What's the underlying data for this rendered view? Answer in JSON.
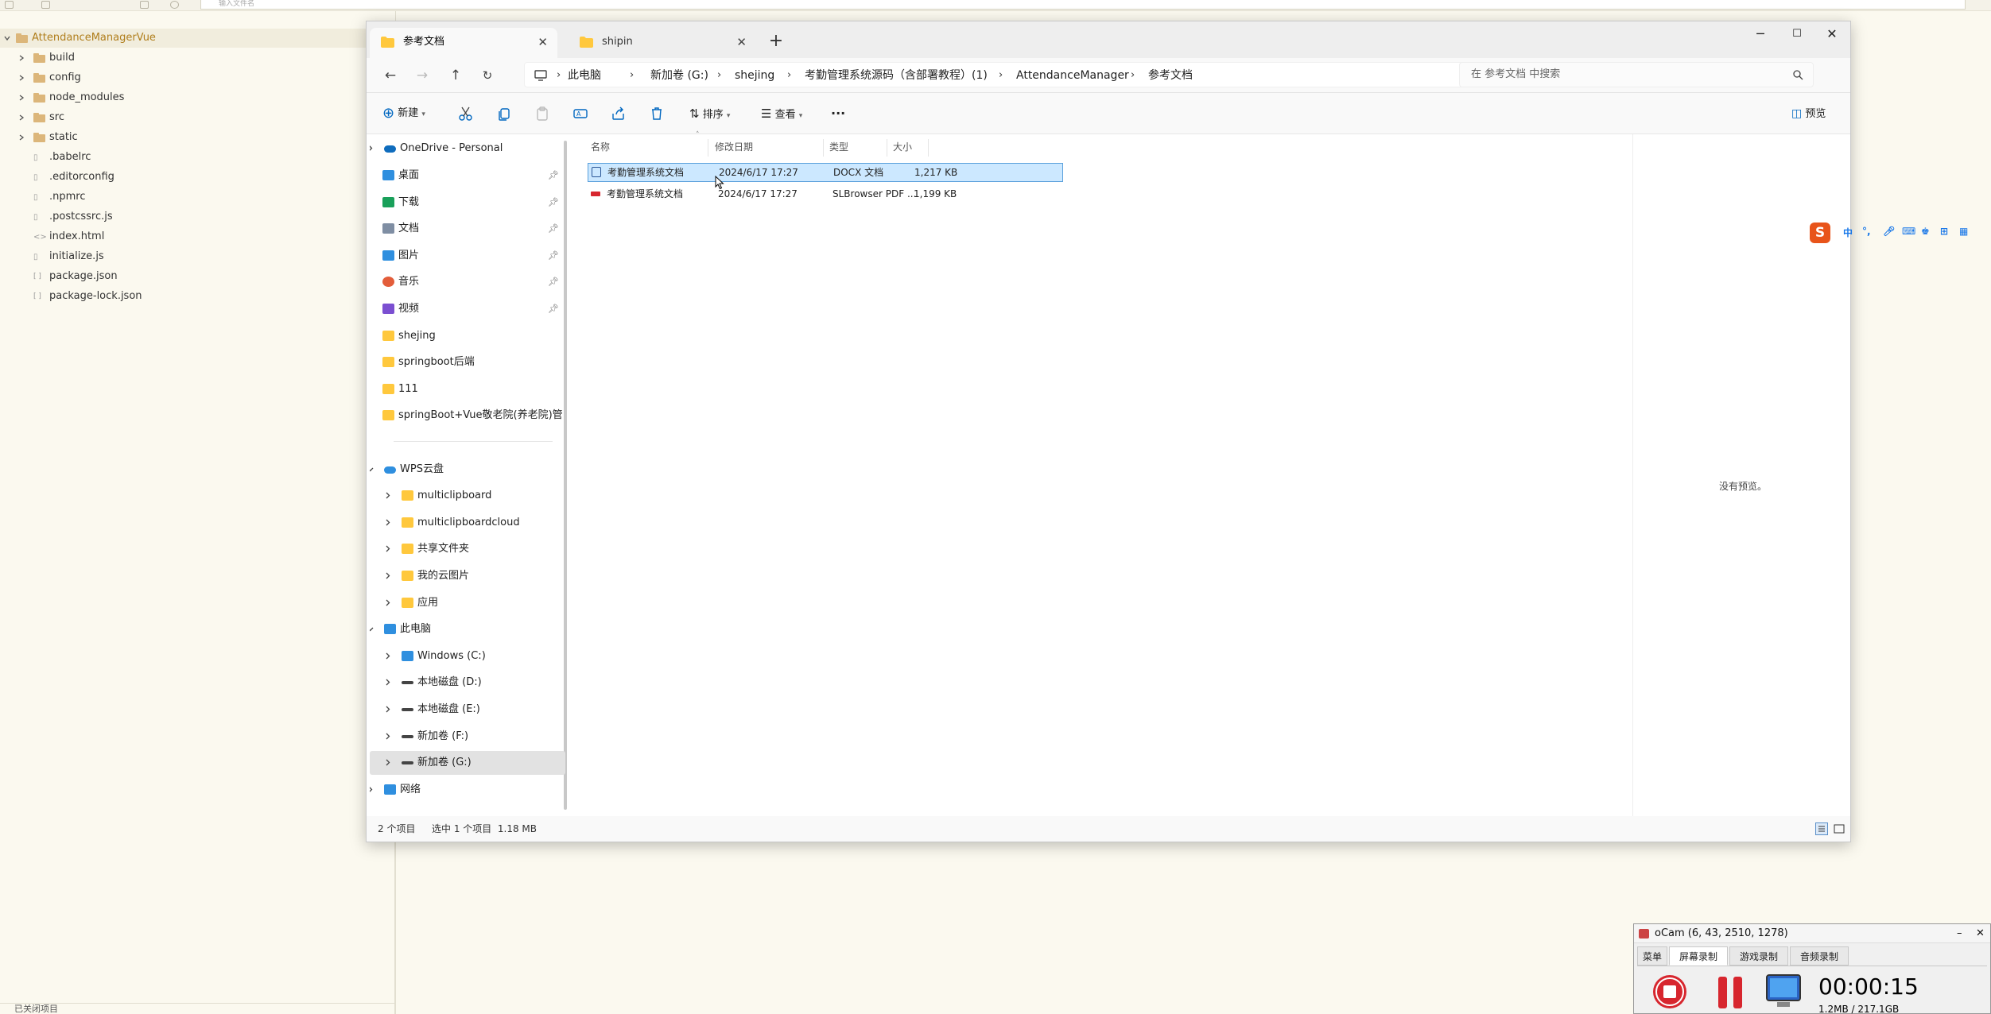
{
  "ide": {
    "search_placeholder": "输入文件名",
    "tree": [
      {
        "label": "AttendanceManagerVue",
        "type": "root-folder",
        "expanded": true
      },
      {
        "label": "build",
        "type": "folder"
      },
      {
        "label": "config",
        "type": "folder"
      },
      {
        "label": "node_modules",
        "type": "folder"
      },
      {
        "label": "src",
        "type": "folder"
      },
      {
        "label": "static",
        "type": "folder"
      },
      {
        "label": ".babelrc",
        "type": "file"
      },
      {
        "label": ".editorconfig",
        "type": "file"
      },
      {
        "label": ".npmrc",
        "type": "file"
      },
      {
        "label": ".postcssrc.js",
        "type": "file"
      },
      {
        "label": "index.html",
        "type": "file"
      },
      {
        "label": "initialize.js",
        "type": "file"
      },
      {
        "label": "package.json",
        "type": "file"
      },
      {
        "label": "package-lock.json",
        "type": "file"
      }
    ],
    "bottom_label": "已关闭项目"
  },
  "explorer": {
    "tabs": [
      {
        "label": "参考文档",
        "active": true
      },
      {
        "label": "shipin",
        "active": false
      }
    ],
    "breadcrumb": [
      "此电脑",
      "新加卷 (G:)",
      "shejing",
      "考勤管理系统源码（含部署教程）(1)",
      "AttendanceManager",
      "参考文档"
    ],
    "search_placeholder": "在 参考文档 中搜索",
    "toolbar": {
      "new_label": "新建",
      "sort_label": "排序",
      "view_label": "查看",
      "more_label": "···",
      "preview_label": "预览"
    },
    "nav": {
      "onedrive": "OneDrive - Personal",
      "quick_access": [
        {
          "label": "桌面",
          "icon": "desktop-icon",
          "pinned": true
        },
        {
          "label": "下载",
          "icon": "download-icon",
          "pinned": true
        },
        {
          "label": "文档",
          "icon": "documents-icon",
          "pinned": true
        },
        {
          "label": "图片",
          "icon": "pictures-icon",
          "pinned": true
        },
        {
          "label": "音乐",
          "icon": "music-icon",
          "pinned": true
        },
        {
          "label": "视频",
          "icon": "videos-icon",
          "pinned": true
        },
        {
          "label": "shejing",
          "icon": "folder-icon",
          "pinned": false
        },
        {
          "label": "springboot后端",
          "icon": "folder-icon",
          "pinned": false
        },
        {
          "label": "111",
          "icon": "folder-icon",
          "pinned": false
        },
        {
          "label": "springBoot+Vue敬老院(养老院)管",
          "icon": "folder-icon",
          "pinned": false
        }
      ],
      "wps": "WPS云盘",
      "wps_items": [
        "multiclipboard",
        "multiclipboardcloud",
        "共享文件夹",
        "我的云图片",
        "应用"
      ],
      "this_pc": "此电脑",
      "drives": [
        "Windows (C:)",
        "本地磁盘 (D:)",
        "本地磁盘 (E:)",
        "新加卷 (F:)",
        "新加卷 (G:)"
      ],
      "network": "网络"
    },
    "columns": {
      "name": "名称",
      "modified": "修改日期",
      "type": "类型",
      "size": "大小"
    },
    "files": [
      {
        "name": "考勤管理系统文档",
        "modified": "2024/6/17 17:27",
        "type": "DOCX 文档",
        "size": "1,217 KB",
        "selected": true,
        "icon": "docx-icon"
      },
      {
        "name": "考勤管理系统文档",
        "modified": "2024/6/17 17:27",
        "type": "SLBrowser PDF ...",
        "size": "1,199 KB",
        "selected": false,
        "icon": "pdf-icon"
      }
    ],
    "preview_empty": "没有预览。",
    "status": {
      "count": "2 个项目",
      "selected": "选中 1 个项目  1.18 MB"
    }
  },
  "ime": {
    "logo": "S",
    "mode": "中"
  },
  "ocam": {
    "title": "oCam (6, 43, 2510, 1278)",
    "tabs": [
      "菜单",
      "屏幕录制",
      "游戏录制",
      "音频录制"
    ],
    "active_tab": "屏幕录制",
    "timer": "00:00:15",
    "size": "1.2MB / 217.1GB",
    "buttons": [
      "录制",
      "暂停",
      "屏幕尺寸"
    ]
  },
  "colors": {
    "accent": "#0067c0",
    "selection": "#cce8ff",
    "folder": "#ffc83d",
    "ocam_red": "#d7262e"
  }
}
